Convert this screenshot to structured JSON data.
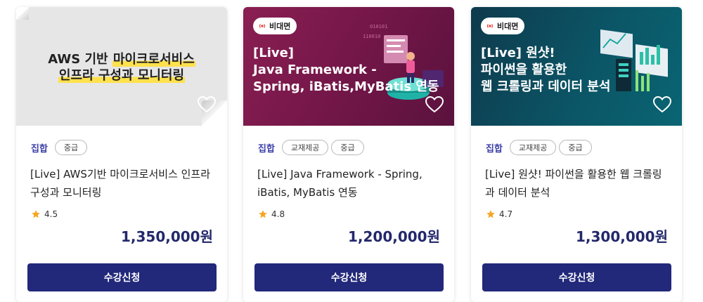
{
  "courses": [
    {
      "thumb_line1_pre": "AWS 기반 ",
      "thumb_line1_hl": "마이크로서비스",
      "thumb_line2_hl": "인프라 구성과 모니터링",
      "category": "집합",
      "chips": [
        "중급"
      ],
      "title": "[Live] AWS기반 마이크로서비스 인프라 구성과 모니터링",
      "rating": "4.5",
      "price": "1,350,000원",
      "button": "수강신청"
    },
    {
      "badge": "비대면",
      "thumb_text": "[Live]\nJava Framework -\nSpring, iBatis,MyBatis 연동",
      "category": "집합",
      "chips": [
        "교재제공",
        "중급"
      ],
      "title": "[Live] Java Framework - Spring, iBatis, MyBatis 연동",
      "rating": "4.8",
      "price": "1,200,000원",
      "button": "수강신청"
    },
    {
      "badge": "비대면",
      "thumb_text": "[Live] 원샷!\n파이썬을 활용한\n웹 크롤링과 데이터 분석",
      "category": "집합",
      "chips": [
        "교재제공",
        "중급"
      ],
      "title": "[Live] 원샷! 파이썬을 활용한 웹 크롤링과 데이터 분석",
      "rating": "4.7",
      "price": "1,300,000원",
      "button": "수강신청"
    }
  ],
  "icons": {
    "heart": "heart-outline-icon",
    "star": "star-icon",
    "live": "broadcast-icon"
  },
  "colors": {
    "accent": "#22287a",
    "star": "#f5a623",
    "category": "#3c3fa8"
  }
}
